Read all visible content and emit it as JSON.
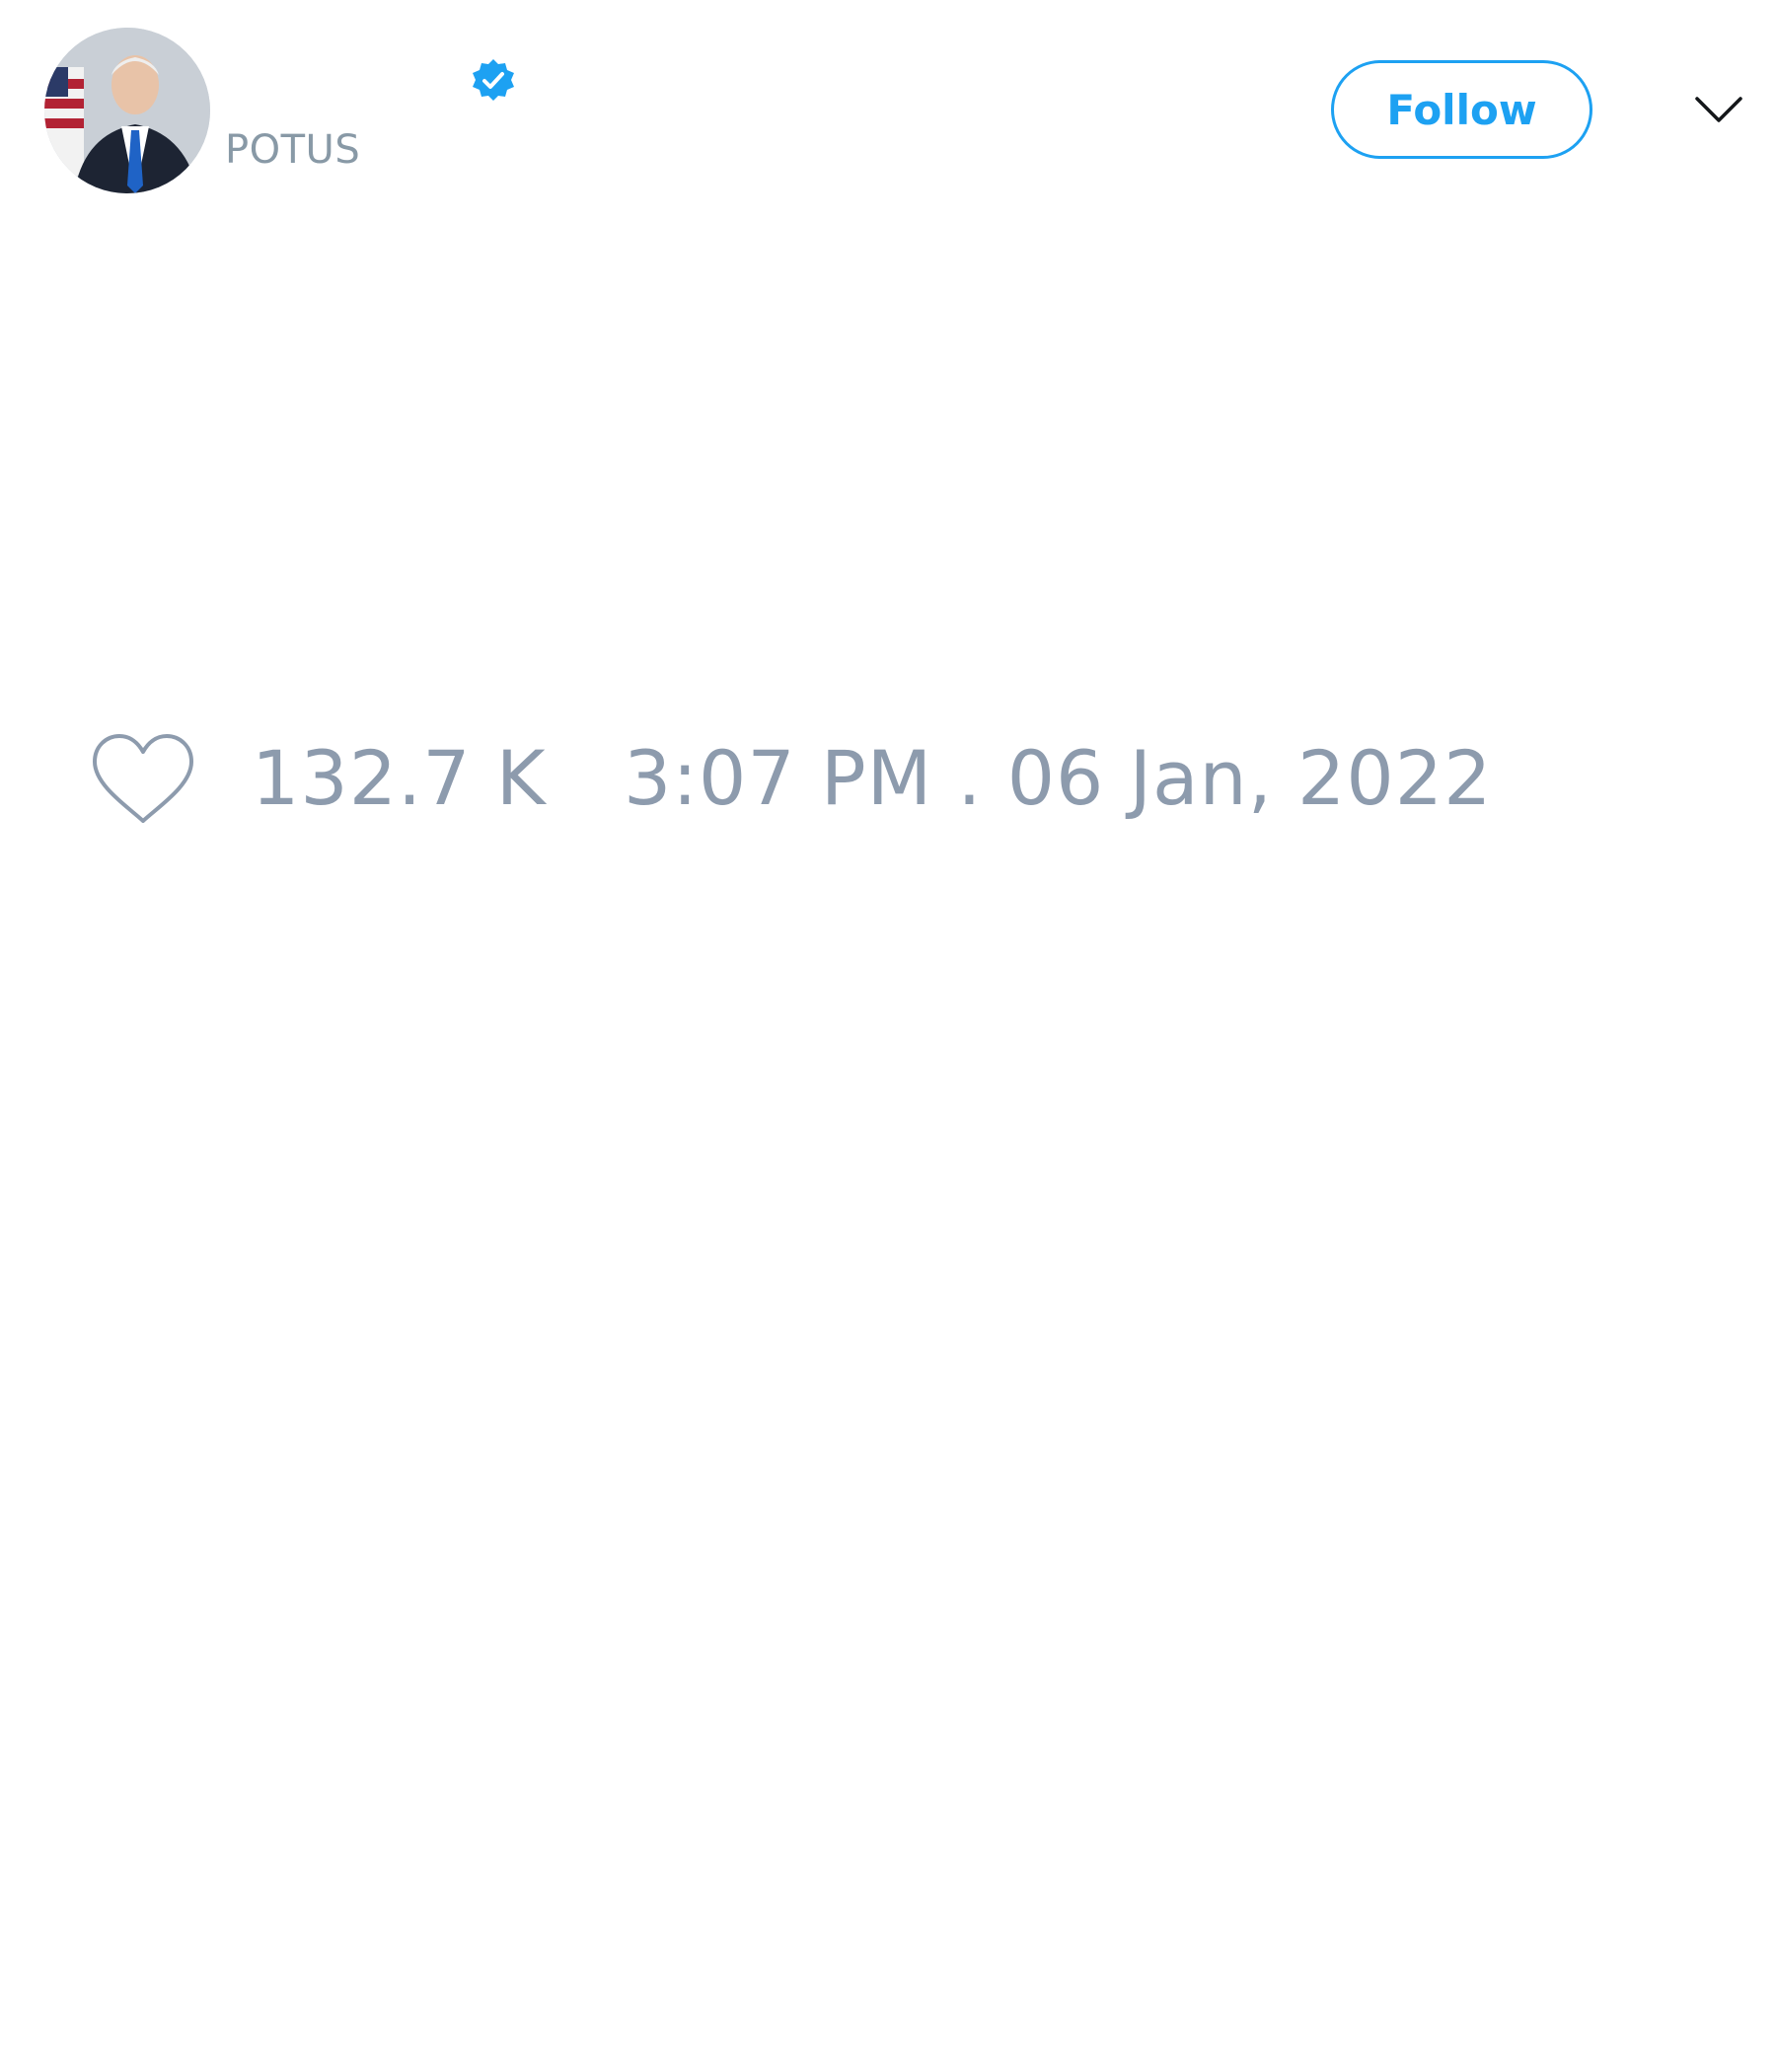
{
  "author": {
    "display_name": "",
    "handle": "POTUS",
    "verified": true,
    "avatar": "portrait-photo"
  },
  "actions": {
    "follow_label": "Follow",
    "more_icon": "chevron-down-icon"
  },
  "tweet": {
    "text": ""
  },
  "stats": {
    "like_icon": "heart-outline-icon",
    "likes": "132.7 K",
    "timestamp": "3:07 PM . 06 Jan, 2022"
  },
  "colors": {
    "accent": "#1da1f2",
    "muted": "#8d9bad",
    "background": "#ffffff"
  }
}
